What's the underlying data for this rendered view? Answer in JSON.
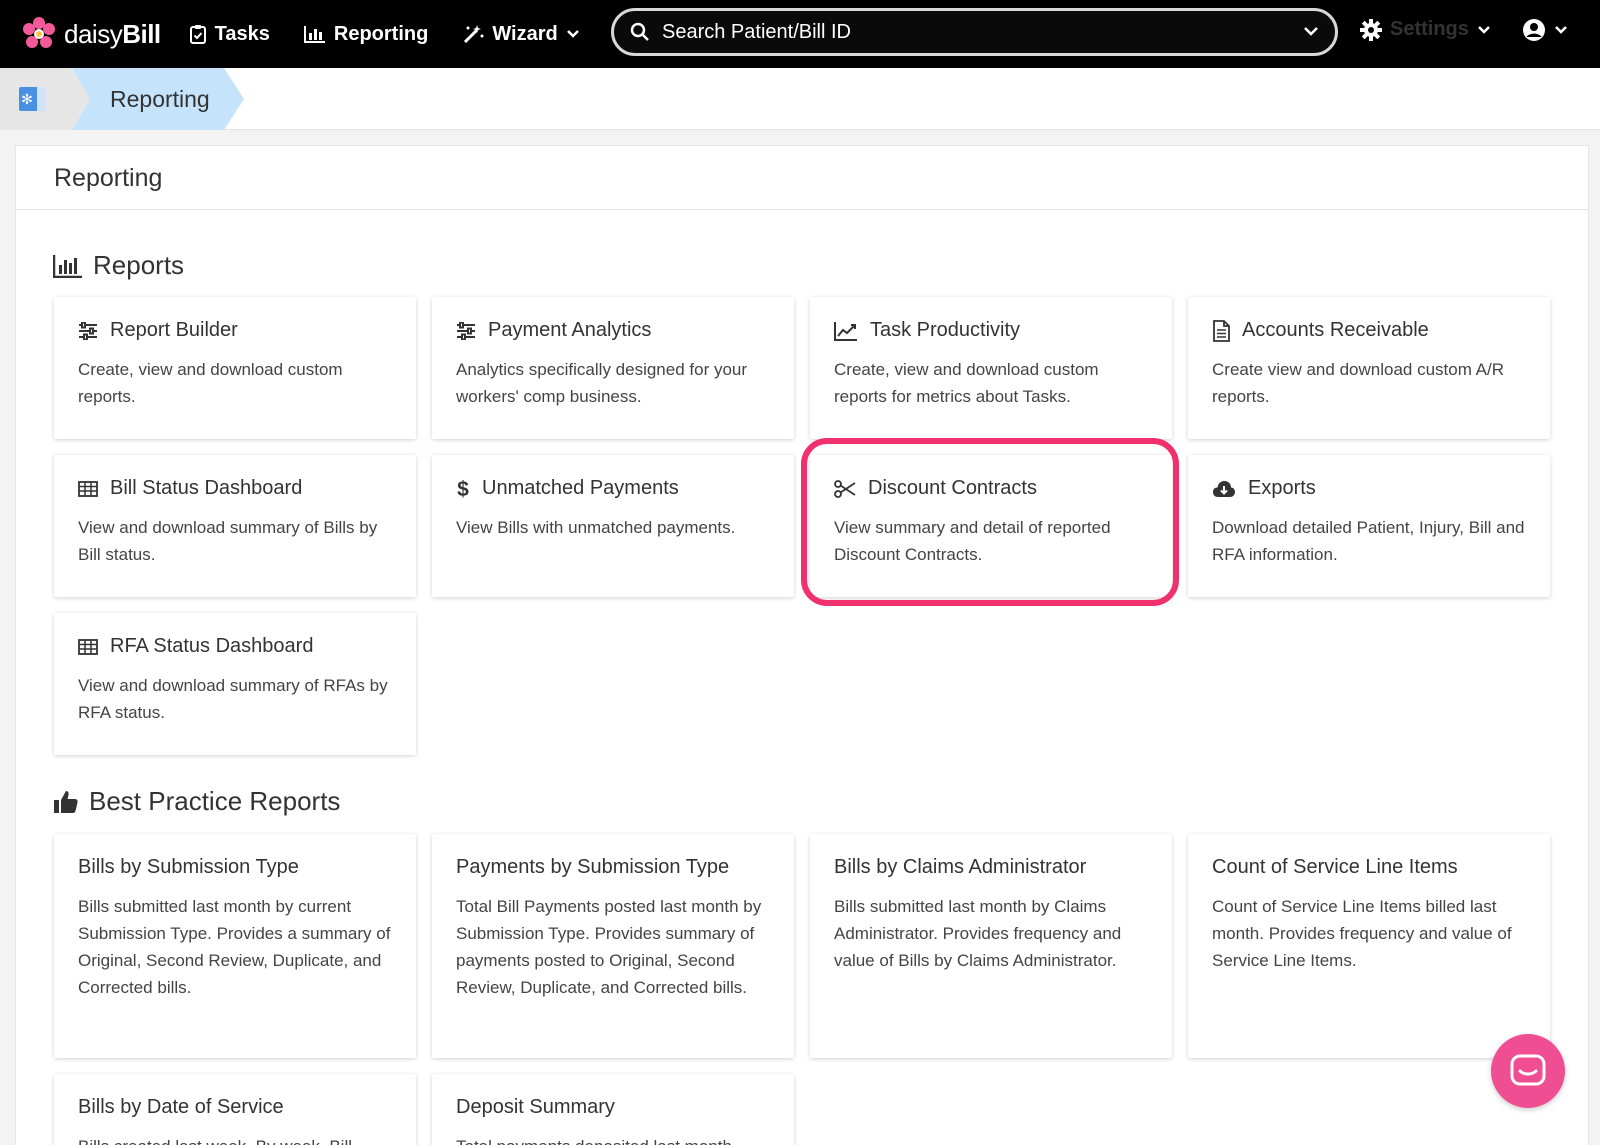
{
  "nav": {
    "logo_text_light": "daisy",
    "logo_text_bold": "Bill",
    "tasks": "Tasks",
    "reporting": "Reporting",
    "wizard": "Wizard",
    "search_placeholder": "Search Patient/Bill ID",
    "settings": "Settings"
  },
  "breadcrumb": {
    "current": "Reporting"
  },
  "page_title": "Reporting",
  "reports_heading": "Reports",
  "reports": [
    {
      "title": "Report Builder",
      "desc": "Create, view and download custom reports.",
      "icon": "sliders-icon"
    },
    {
      "title": "Payment Analytics",
      "desc": "Analytics specifically designed for your workers' comp business.",
      "icon": "sliders-icon"
    },
    {
      "title": "Task Productivity",
      "desc": "Create, view and download custom reports for metrics about Tasks.",
      "icon": "line-chart-icon"
    },
    {
      "title": "Accounts Receivable",
      "desc": "Create view and download custom A/R reports.",
      "icon": "document-icon"
    },
    {
      "title": "Bill Status Dashboard",
      "desc": "View and download summary of Bills by Bill status.",
      "icon": "table-icon"
    },
    {
      "title": "Unmatched Payments",
      "desc": "View Bills with unmatched payments.",
      "icon": "dollar-icon"
    },
    {
      "title": "Discount Contracts",
      "desc": "View summary and detail of reported Discount Contracts.",
      "icon": "scissors-icon"
    },
    {
      "title": "Exports",
      "desc": "Download detailed Patient, Injury, Bill and RFA information.",
      "icon": "cloud-download-icon"
    },
    {
      "title": "RFA Status Dashboard",
      "desc": "View and download summary of RFAs by RFA status.",
      "icon": "table-icon"
    }
  ],
  "best_heading": "Best Practice Reports",
  "best": [
    {
      "title": "Bills by Submission Type",
      "desc": "Bills submitted last month by current Submission Type. Provides a summary of Original, Second Review, Duplicate, and Corrected bills."
    },
    {
      "title": "Payments by Submission Type",
      "desc": "Total Bill Payments posted last month by Submission Type. Provides summary of payments posted to Original, Second Review, Duplicate, and Corrected bills."
    },
    {
      "title": "Bills by Claims Administrator",
      "desc": "Bills submitted last month by Claims Administrator. Provides frequency and value of Bills by Claims Administrator."
    },
    {
      "title": "Count of Service Line Items",
      "desc": "Count of Service Line Items billed last month. Provides frequency and value of Service Line Items."
    },
    {
      "title": "Bills by Date of Service",
      "desc": "Bills created last week. By week. Bill"
    },
    {
      "title": "Deposit Summary",
      "desc": "Total payments deposited last month"
    }
  ],
  "colors": {
    "highlight": "#f0316e",
    "crumb_active": "#c5e4fb",
    "chat": "#f04e93"
  }
}
